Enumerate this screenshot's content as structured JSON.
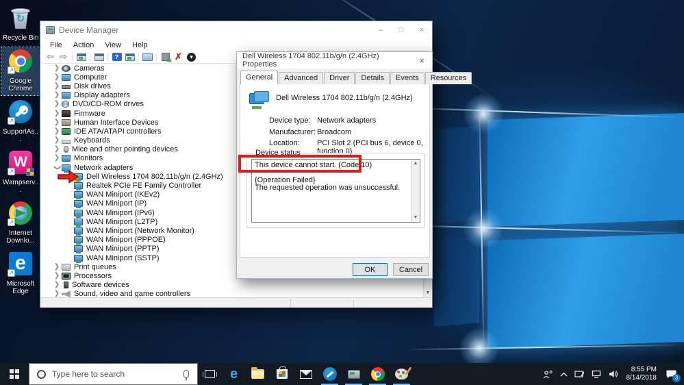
{
  "desktop": {
    "icons": [
      {
        "label": "Recycle Bin",
        "icon": "recycle-bin-icon",
        "shortcut": false,
        "selected": false
      },
      {
        "label": "Google Chrome",
        "icon": "chrome-icon",
        "shortcut": true,
        "selected": true
      },
      {
        "label": "SupportAs...",
        "icon": "supportassist-icon",
        "shortcut": true,
        "selected": false
      },
      {
        "label": "Wampserv...",
        "icon": "wampserver-icon",
        "shortcut": true,
        "selected": false
      },
      {
        "label": "Internet Downlo...",
        "icon": "idm-icon",
        "shortcut": true,
        "selected": false
      },
      {
        "label": "Microsoft Edge",
        "icon": "edge-icon",
        "shortcut": true,
        "selected": false
      }
    ]
  },
  "device_manager": {
    "title": "Device Manager",
    "menu": [
      "File",
      "Action",
      "View",
      "Help"
    ],
    "toolbar": [
      "back-icon",
      "forward-icon",
      "sep",
      "console-window-icon",
      "sep",
      "export-list-icon",
      "sep",
      "help-icon",
      "console-window-icon",
      "sep",
      "scan-hardware-icon",
      "sep",
      "update-driver-icon",
      "uninstall-device-icon",
      "disable-device-icon"
    ],
    "tree": [
      {
        "label": "Cameras",
        "icon": "camera-icon",
        "level": 0,
        "state": "collapsed"
      },
      {
        "label": "Computer",
        "icon": "computer-icon",
        "level": 0,
        "state": "collapsed"
      },
      {
        "label": "Disk drives",
        "icon": "disk-icon",
        "level": 0,
        "state": "collapsed"
      },
      {
        "label": "Display adapters",
        "icon": "display-icon",
        "level": 0,
        "state": "collapsed"
      },
      {
        "label": "DVD/CD-ROM drives",
        "icon": "dvd-icon",
        "level": 0,
        "state": "collapsed"
      },
      {
        "label": "Firmware",
        "icon": "firmware-icon",
        "level": 0,
        "state": "collapsed"
      },
      {
        "label": "Human Interface Devices",
        "icon": "hid-icon",
        "level": 0,
        "state": "collapsed"
      },
      {
        "label": "IDE ATA/ATAPI controllers",
        "icon": "ide-icon",
        "level": 0,
        "state": "collapsed"
      },
      {
        "label": "Keyboards",
        "icon": "keyboard-icon",
        "level": 0,
        "state": "collapsed"
      },
      {
        "label": "Mice and other pointing devices",
        "icon": "mouse-icon",
        "level": 0,
        "state": "collapsed"
      },
      {
        "label": "Monitors",
        "icon": "monitor-icon",
        "level": 0,
        "state": "collapsed"
      },
      {
        "label": "Network adapters",
        "icon": "network-icon",
        "level": 0,
        "state": "expanded"
      },
      {
        "label": "Dell Wireless 1704 802.11b/g/n (2.4GHz)",
        "icon": "network-adapter-icon",
        "level": 1,
        "warning": true
      },
      {
        "label": "Realtek PCIe FE Family Controller",
        "icon": "network-adapter-icon",
        "level": 1
      },
      {
        "label": "WAN Miniport (IKEv2)",
        "icon": "network-adapter-icon",
        "level": 1
      },
      {
        "label": "WAN Miniport (IP)",
        "icon": "network-adapter-icon",
        "level": 1
      },
      {
        "label": "WAN Miniport (IPv6)",
        "icon": "network-adapter-icon",
        "level": 1
      },
      {
        "label": "WAN Miniport (L2TP)",
        "icon": "network-adapter-icon",
        "level": 1
      },
      {
        "label": "WAN Miniport (Network Monitor)",
        "icon": "network-adapter-icon",
        "level": 1
      },
      {
        "label": "WAN Miniport (PPPOE)",
        "icon": "network-adapter-icon",
        "level": 1
      },
      {
        "label": "WAN Miniport (PPTP)",
        "icon": "network-adapter-icon",
        "level": 1
      },
      {
        "label": "WAN Miniport (SSTP)",
        "icon": "network-adapter-icon",
        "level": 1
      },
      {
        "label": "Print queues",
        "icon": "print-icon",
        "level": 0,
        "state": "collapsed"
      },
      {
        "label": "Processors",
        "icon": "processor-icon",
        "level": 0,
        "state": "collapsed"
      },
      {
        "label": "Software devices",
        "icon": "software-icon",
        "level": 0,
        "state": "collapsed"
      },
      {
        "label": "Sound, video and game controllers",
        "icon": "sound-icon",
        "level": 0,
        "state": "collapsed"
      }
    ]
  },
  "dialog": {
    "title": "Dell Wireless 1704 802.11b/g/n (2.4GHz) Properties",
    "tabs": [
      "General",
      "Advanced",
      "Driver",
      "Details",
      "Events",
      "Resources"
    ],
    "active_tab": "General",
    "device_name": "Dell Wireless 1704 802.11b/g/n (2.4GHz)",
    "fields": [
      {
        "label": "Device type:",
        "value": "Network adapters"
      },
      {
        "label": "Manufacturer:",
        "value": "Broadcom"
      },
      {
        "label": "Location:",
        "value": "PCI Slot 2 (PCI bus 6, device 0, function 0)"
      }
    ],
    "status_group_label": "Device status",
    "status_lines": [
      "This device cannot start. (Code 10)",
      "",
      "{Operation Failed}",
      "The requested operation was unsuccessful."
    ],
    "buttons": {
      "ok": "OK",
      "cancel": "Cancel"
    }
  },
  "window_controls": {
    "minimize": "–",
    "maximize": "□",
    "close": "×"
  },
  "annotations": {
    "box_target": "This device cannot start. (Code 10)",
    "arrow_target": "Dell Wireless 1704 802.11b/g/n (2.4GHz)",
    "color": "#e01b1b"
  },
  "taskbar": {
    "search_placeholder": "Type here to search",
    "icons": [
      {
        "name": "task-view-icon",
        "open": false
      },
      {
        "name": "edge-icon",
        "open": false
      },
      {
        "name": "file-explorer-icon",
        "open": false
      },
      {
        "name": "store-icon",
        "open": false
      },
      {
        "name": "mail-icon",
        "open": false
      },
      {
        "name": "supportassist-icon",
        "open": true
      },
      {
        "name": "device-manager-icon",
        "open": true
      },
      {
        "name": "chrome-icon",
        "open": true
      },
      {
        "name": "paint-icon",
        "open": true
      }
    ],
    "tray": {
      "time": "8:55 PM",
      "date": "8/14/2018",
      "notification_count": "3"
    }
  },
  "colors": {
    "annotation_red": "#e01b1b",
    "warning_yellow": "#f5c400",
    "taskbar_underline": "#76b9ed",
    "accent_blue": "#0078d7"
  }
}
